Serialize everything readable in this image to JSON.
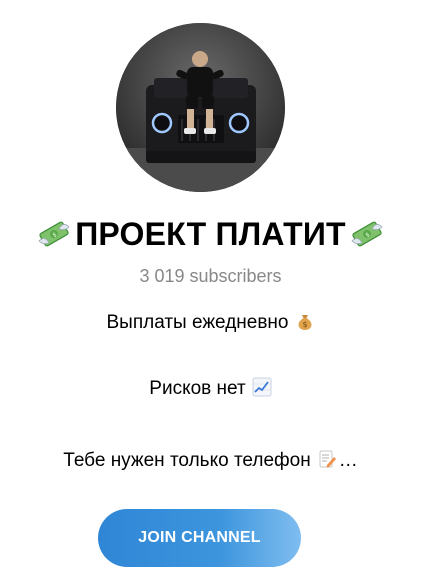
{
  "channel": {
    "title": "ПРОЕКТ ПЛАТИТ",
    "subscribers": "3 019 subscribers",
    "avatar_icon": "channel-avatar-photo",
    "title_icon": "money-with-wings-icon"
  },
  "description": {
    "line1": "Выплаты ежедневно",
    "line1_icon": "money-bag-icon",
    "line2": "Рисков нет",
    "line2_icon": "chart-increasing-icon",
    "line3": "Тебе нужен только телефон",
    "line3_icon": "memo-icon",
    "line3_suffix": "…"
  },
  "actions": {
    "join_label": "JOIN CHANNEL"
  },
  "colors": {
    "button_gradient_start": "#2f86d6",
    "button_gradient_end": "#7fbdf0",
    "subscribers_text": "#888888"
  }
}
